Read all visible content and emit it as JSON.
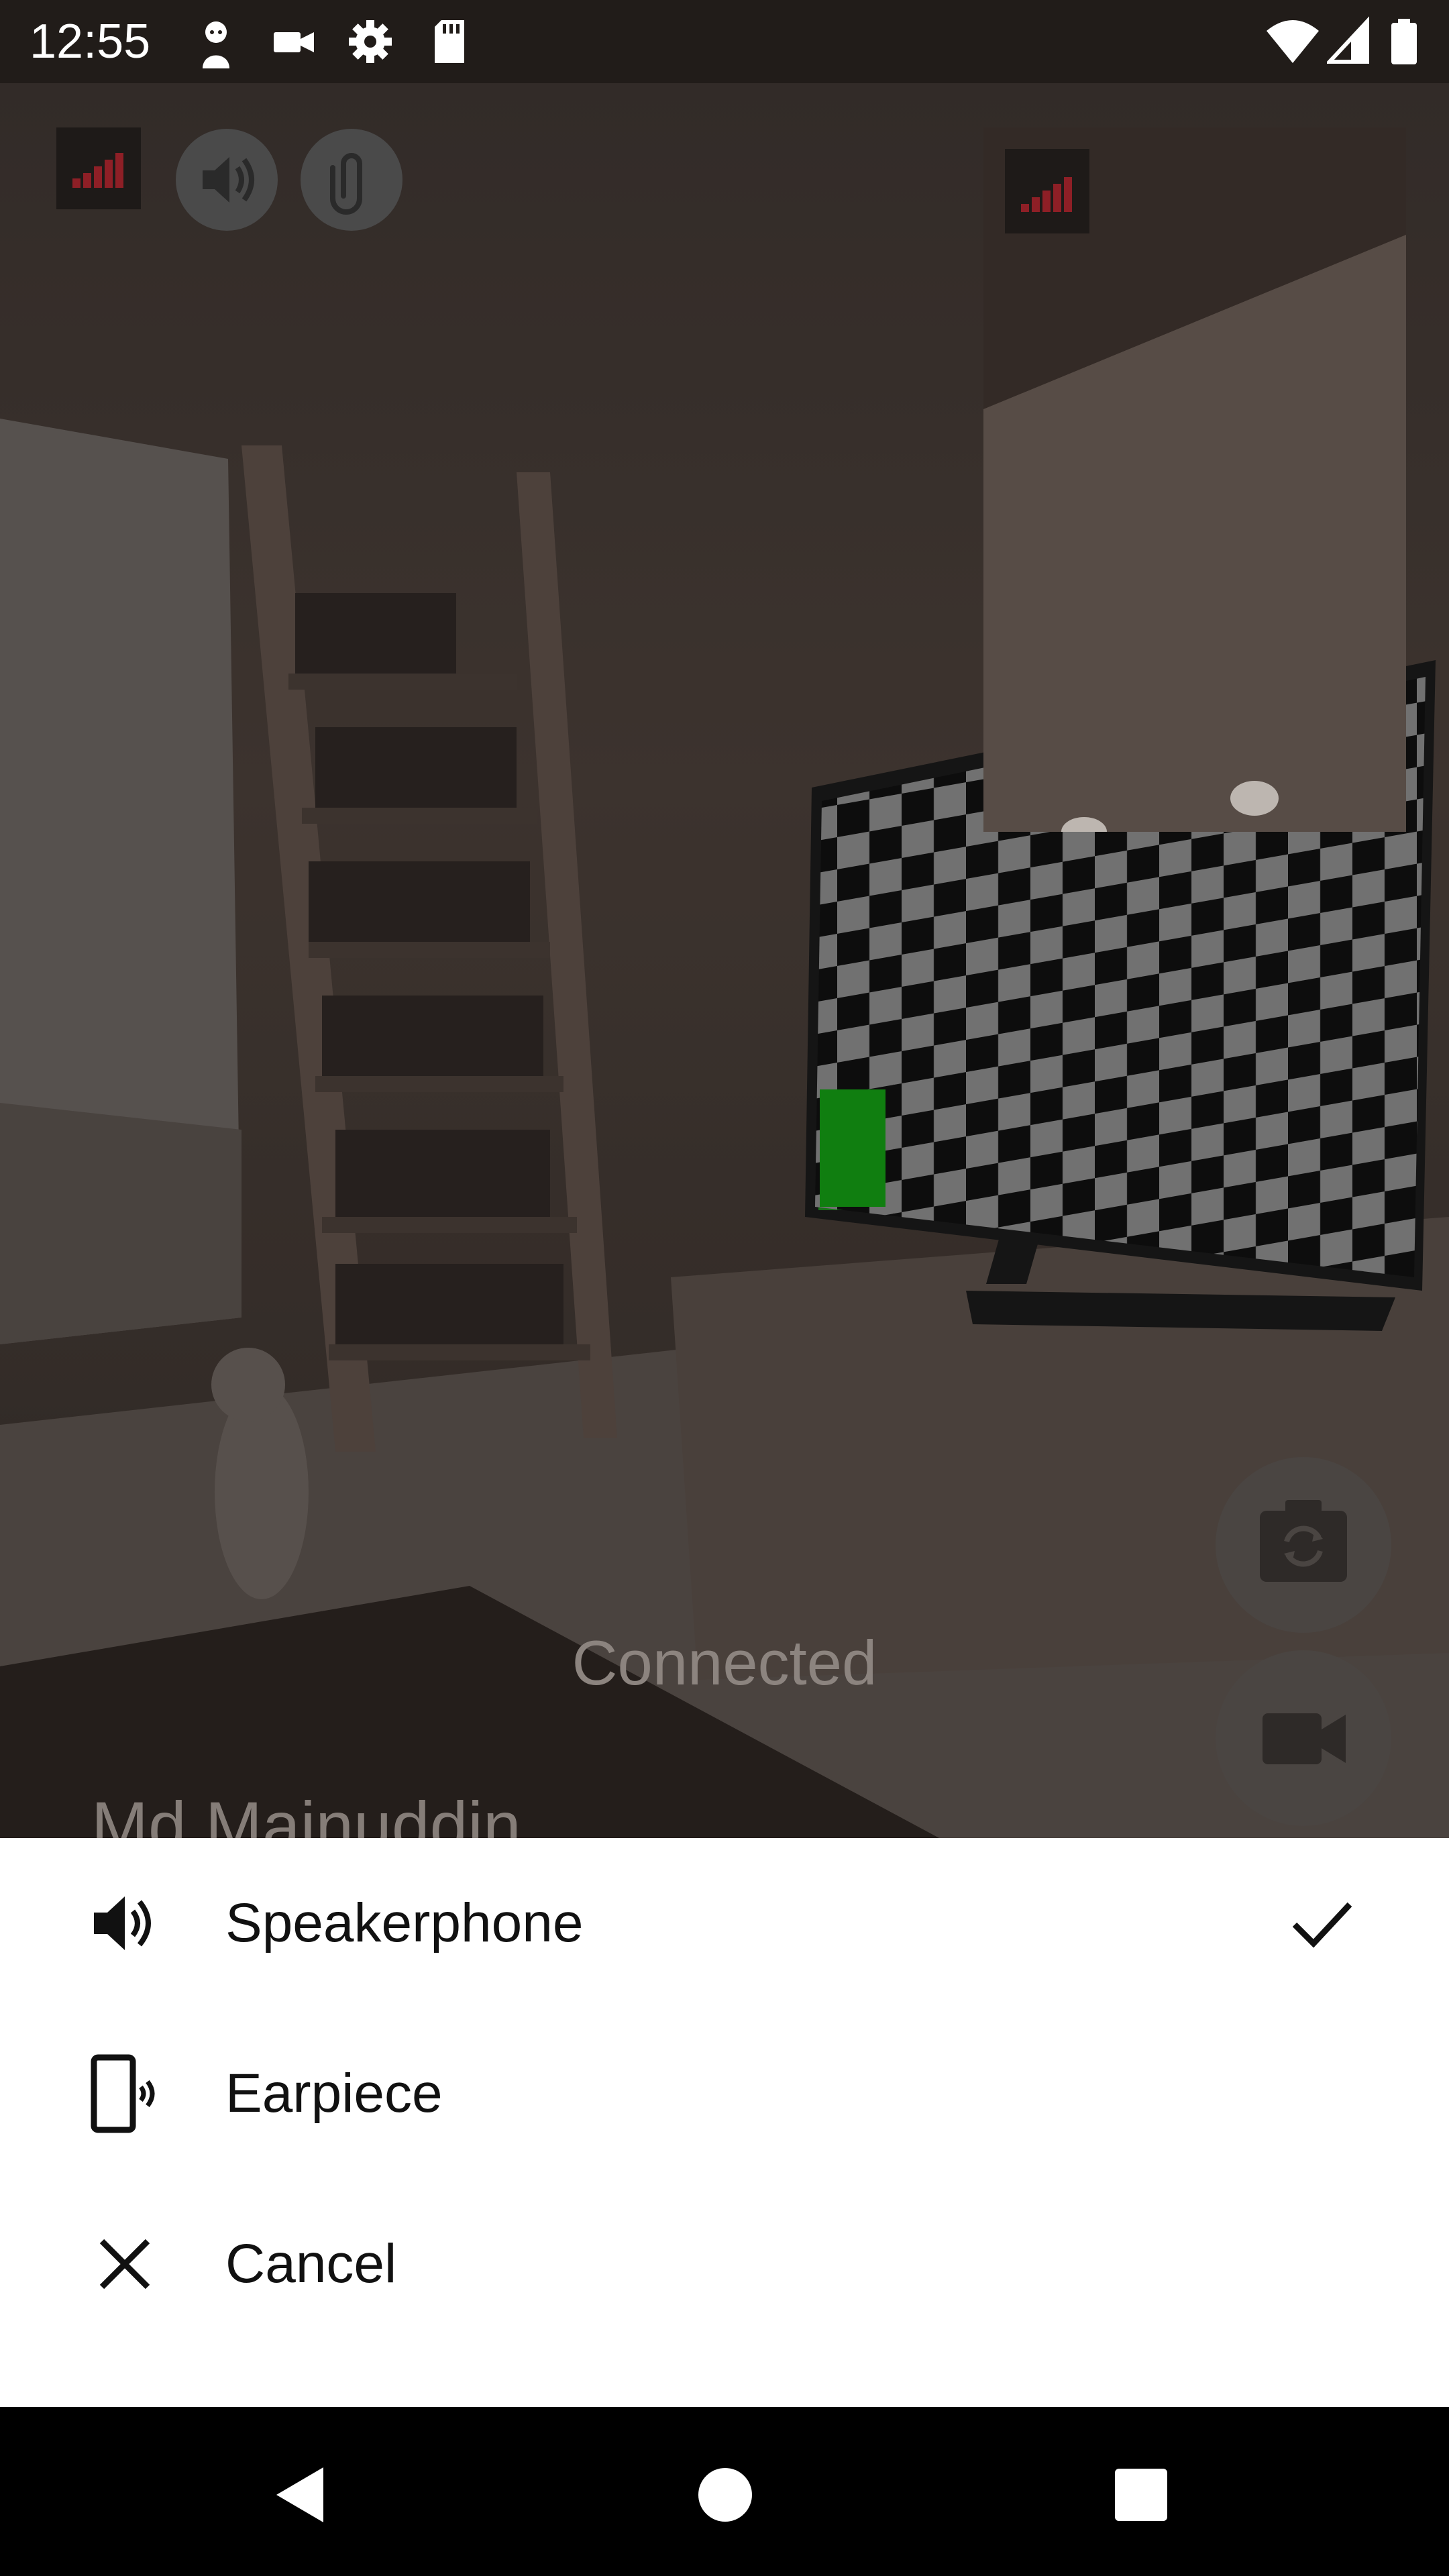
{
  "status_bar": {
    "time": "12:55",
    "icons": [
      "avatar-icon",
      "video-camera-icon",
      "settings-icon",
      "sd-card-icon",
      "wifi-icon",
      "cellular-signal-icon",
      "battery-icon"
    ]
  },
  "call": {
    "status": "Connected",
    "caller_name": "Md Mainuddin",
    "top_controls": [
      "signal-strength-icon",
      "speaker-icon",
      "attachment-icon"
    ],
    "side_controls": [
      "switch-camera-icon",
      "video-camera-icon"
    ]
  },
  "audio_menu": {
    "options": [
      {
        "label": "Speakerphone",
        "icon": "speaker-icon",
        "selected": true
      },
      {
        "label": "Earpiece",
        "icon": "earpiece-icon",
        "selected": false
      },
      {
        "label": "Cancel",
        "icon": "close-icon",
        "selected": false
      }
    ]
  },
  "nav_bar": [
    "back-icon",
    "home-icon",
    "recents-icon"
  ]
}
